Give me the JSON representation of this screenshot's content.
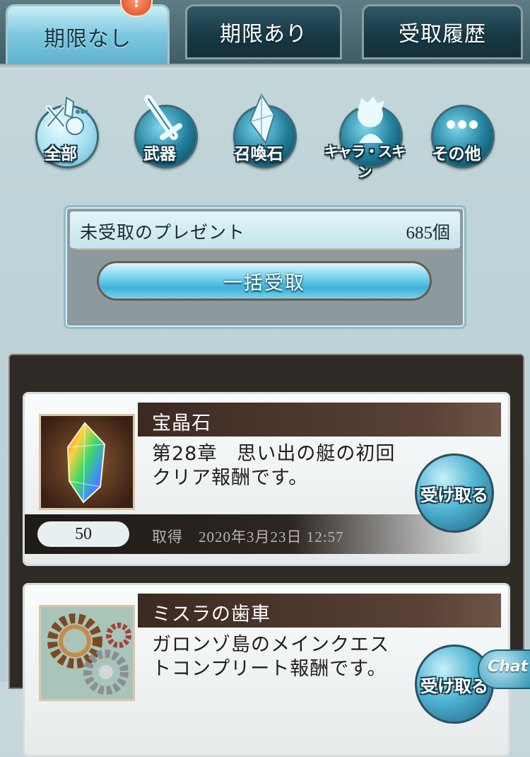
{
  "tabs": [
    {
      "label": "期限なし",
      "active": true
    },
    {
      "label": "期限あり",
      "active": false
    },
    {
      "label": "受取履歴",
      "active": false
    }
  ],
  "tab_badge": "!",
  "categories": [
    {
      "label": "全部",
      "icon": "all-items-icon",
      "selected": true
    },
    {
      "label": "武器",
      "icon": "sword-icon",
      "selected": false
    },
    {
      "label": "召喚石",
      "icon": "crystal-icon",
      "selected": false
    },
    {
      "label": "キャラ・スキン",
      "icon": "character-silhouette-icon",
      "selected": false
    },
    {
      "label": "その他",
      "icon": "more-dots-icon",
      "selected": false
    }
  ],
  "summary": {
    "title": "未受取のプレゼント",
    "count": "685個",
    "bulk_button": "一括受取"
  },
  "items": [
    {
      "name": "宝晶石",
      "description_line1": "第28章　思い出の艇の初回",
      "description_line2": "クリア報酬です。",
      "quantity": "50",
      "date": "取得　2020年3月23日 12:57",
      "button": "受け取る",
      "thumb_icon": "rainbow-crystal-icon"
    },
    {
      "name": "ミスラの歯車",
      "description_line1": "ガロンゾ島のメインクエス",
      "description_line2": "トコンプリート報酬です。",
      "button": "受け取る",
      "thumb_icon": "gears-icon"
    }
  ],
  "chat_label": "Chat"
}
